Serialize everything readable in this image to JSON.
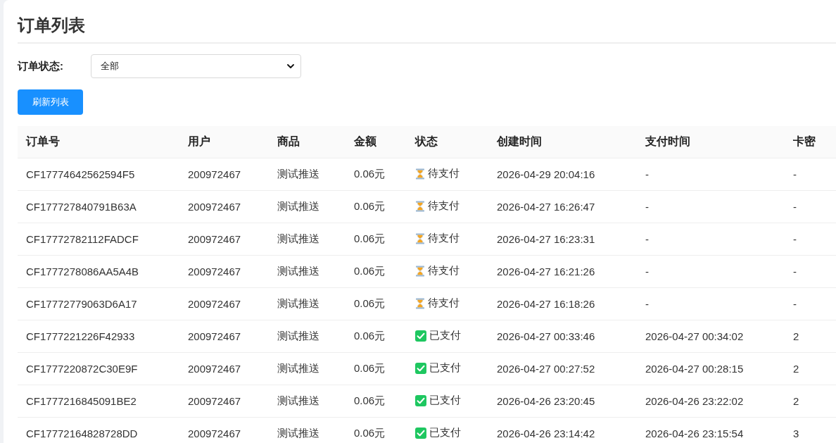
{
  "page": {
    "title": "订单列表"
  },
  "filter": {
    "label": "订单状态:",
    "value": "全部"
  },
  "refresh_button": {
    "label": "刷新列表"
  },
  "table": {
    "columns": [
      "订单号",
      "用户",
      "商品",
      "金额",
      "状态",
      "创建时间",
      "支付时间",
      "卡密"
    ],
    "rows": [
      {
        "order_no": "CF17774642562594F5",
        "user": "200972467",
        "product": "测试推送",
        "amount": "0.06元",
        "status": {
          "kind": "pending",
          "label": "待支付"
        },
        "created": "2026-04-29 20:04:16",
        "paid": "-",
        "card": "-"
      },
      {
        "order_no": "CF177727840791B63A",
        "user": "200972467",
        "product": "测试推送",
        "amount": "0.06元",
        "status": {
          "kind": "pending",
          "label": "待支付"
        },
        "created": "2026-04-27 16:26:47",
        "paid": "-",
        "card": "-"
      },
      {
        "order_no": "CF17772782112FADCF",
        "user": "200972467",
        "product": "测试推送",
        "amount": "0.06元",
        "status": {
          "kind": "pending",
          "label": "待支付"
        },
        "created": "2026-04-27 16:23:31",
        "paid": "-",
        "card": "-"
      },
      {
        "order_no": "CF1777278086AA5A4B",
        "user": "200972467",
        "product": "测试推送",
        "amount": "0.06元",
        "status": {
          "kind": "pending",
          "label": "待支付"
        },
        "created": "2026-04-27 16:21:26",
        "paid": "-",
        "card": "-"
      },
      {
        "order_no": "CF17772779063D6A17",
        "user": "200972467",
        "product": "测试推送",
        "amount": "0.06元",
        "status": {
          "kind": "pending",
          "label": "待支付"
        },
        "created": "2026-04-27 16:18:26",
        "paid": "-",
        "card": "-"
      },
      {
        "order_no": "CF1777221226F42933",
        "user": "200972467",
        "product": "测试推送",
        "amount": "0.06元",
        "status": {
          "kind": "paid",
          "label": "已支付"
        },
        "created": "2026-04-27 00:33:46",
        "paid": "2026-04-27 00:34:02",
        "card": "2"
      },
      {
        "order_no": "CF1777220872C30E9F",
        "user": "200972467",
        "product": "测试推送",
        "amount": "0.06元",
        "status": {
          "kind": "paid",
          "label": "已支付"
        },
        "created": "2026-04-27 00:27:52",
        "paid": "2026-04-27 00:28:15",
        "card": "2"
      },
      {
        "order_no": "CF1777216845091BE2",
        "user": "200972467",
        "product": "测试推送",
        "amount": "0.06元",
        "status": {
          "kind": "paid",
          "label": "已支付"
        },
        "created": "2026-04-26 23:20:45",
        "paid": "2026-04-26 23:22:02",
        "card": "2"
      },
      {
        "order_no": "CF17772164828728DD",
        "user": "200972467",
        "product": "测试推送",
        "amount": "0.06元",
        "status": {
          "kind": "paid",
          "label": "已支付"
        },
        "created": "2026-04-26 23:14:42",
        "paid": "2026-04-26 23:15:54",
        "card": "3"
      }
    ]
  }
}
